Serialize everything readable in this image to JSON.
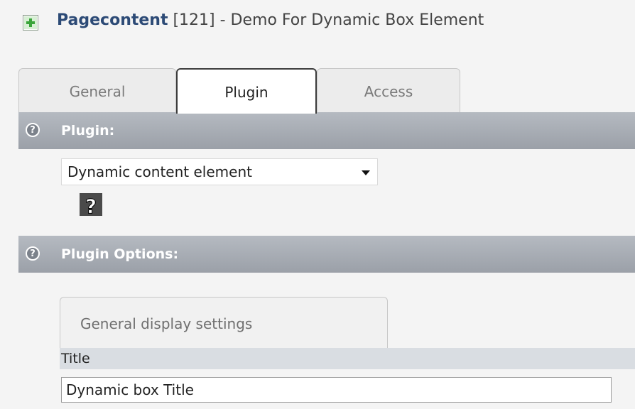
{
  "header": {
    "icon": "page-content-icon",
    "title_strong": "Pagecontent",
    "title_rest": " [121] - Demo For Dynamic Box Element"
  },
  "tabs": [
    {
      "label": "General",
      "active": false
    },
    {
      "label": "Plugin",
      "active": true
    },
    {
      "label": "Access",
      "active": false
    }
  ],
  "plugin_section": {
    "label": "Plugin:",
    "select_value": "Dynamic content element",
    "help_icon": "help-icon"
  },
  "plugin_options_section": {
    "label": "Plugin Options:",
    "subtab_label": "General display settings",
    "field_label": "Title",
    "field_value": "Dynamic box Title"
  }
}
